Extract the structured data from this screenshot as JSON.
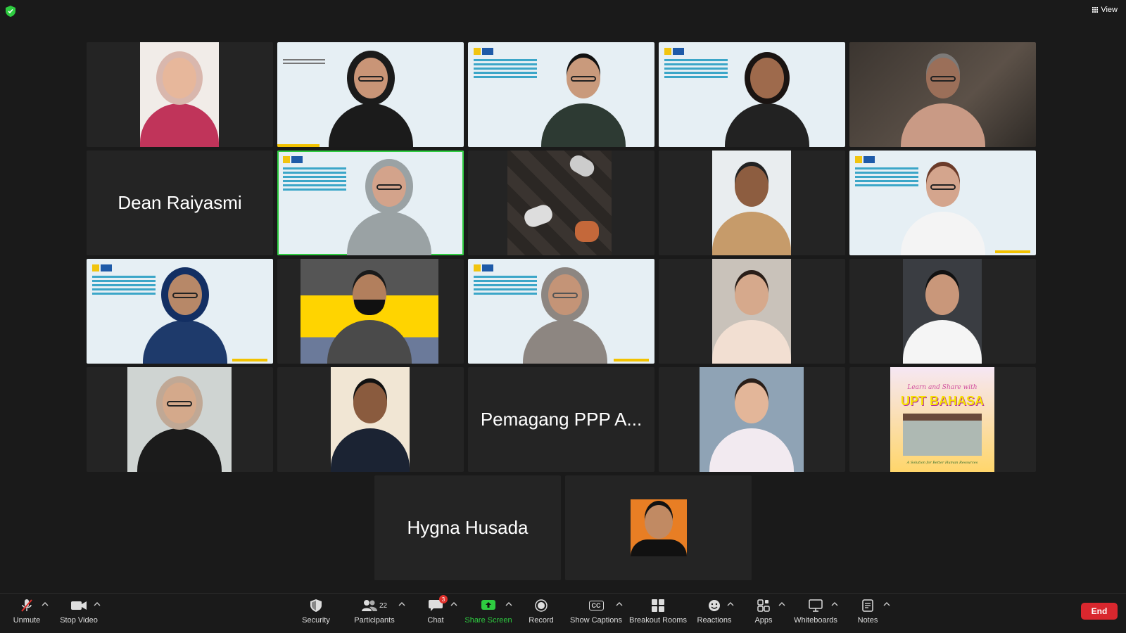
{
  "meeting": {
    "view_label": "View"
  },
  "participants": {
    "dean_name": "Dean Raiyasmi",
    "pemagang_name": "Pemagang PPP A...",
    "hygna_name": "Hygna Husada"
  },
  "upt_banner": {
    "line1": "Learn and Share with",
    "line2": "UPT BAHASA",
    "line3": "A Solution for Better Human Resources"
  },
  "toolbar": {
    "unmute": "Unmute",
    "stop_video": "Stop Video",
    "security": "Security",
    "participants": "Participants",
    "participants_count": "22",
    "chat": "Chat",
    "chat_badge": "3",
    "share_screen": "Share Screen",
    "record": "Record",
    "show_captions": "Show Captions",
    "captions_icon_text": "CC",
    "breakout_rooms": "Breakout Rooms",
    "reactions": "Reactions",
    "apps": "Apps",
    "whiteboards": "Whiteboards",
    "notes": "Notes",
    "end": "End"
  },
  "colors": {
    "background": "#1a1a1a",
    "tile": "#242424",
    "active_speaker": "#2ecc40",
    "end_button": "#d9272e",
    "share_green": "#2ecc40"
  }
}
